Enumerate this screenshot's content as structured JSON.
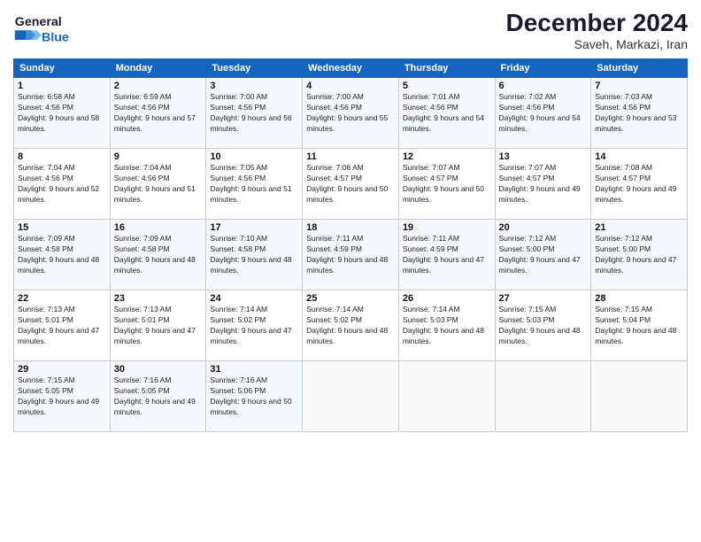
{
  "header": {
    "logo_line1": "General",
    "logo_line2": "Blue",
    "month_title": "December 2024",
    "subtitle": "Saveh, Markazi, Iran"
  },
  "weekdays": [
    "Sunday",
    "Monday",
    "Tuesday",
    "Wednesday",
    "Thursday",
    "Friday",
    "Saturday"
  ],
  "weeks": [
    [
      {
        "day": "1",
        "sunrise": "6:58 AM",
        "sunset": "4:56 PM",
        "daylight": "9 hours and 58 minutes."
      },
      {
        "day": "2",
        "sunrise": "6:59 AM",
        "sunset": "4:56 PM",
        "daylight": "9 hours and 57 minutes."
      },
      {
        "day": "3",
        "sunrise": "7:00 AM",
        "sunset": "4:56 PM",
        "daylight": "9 hours and 56 minutes."
      },
      {
        "day": "4",
        "sunrise": "7:00 AM",
        "sunset": "4:56 PM",
        "daylight": "9 hours and 55 minutes."
      },
      {
        "day": "5",
        "sunrise": "7:01 AM",
        "sunset": "4:56 PM",
        "daylight": "9 hours and 54 minutes."
      },
      {
        "day": "6",
        "sunrise": "7:02 AM",
        "sunset": "4:56 PM",
        "daylight": "9 hours and 54 minutes."
      },
      {
        "day": "7",
        "sunrise": "7:03 AM",
        "sunset": "4:56 PM",
        "daylight": "9 hours and 53 minutes."
      }
    ],
    [
      {
        "day": "8",
        "sunrise": "7:04 AM",
        "sunset": "4:56 PM",
        "daylight": "9 hours and 52 minutes."
      },
      {
        "day": "9",
        "sunrise": "7:04 AM",
        "sunset": "4:56 PM",
        "daylight": "9 hours and 51 minutes."
      },
      {
        "day": "10",
        "sunrise": "7:05 AM",
        "sunset": "4:56 PM",
        "daylight": "9 hours and 51 minutes."
      },
      {
        "day": "11",
        "sunrise": "7:06 AM",
        "sunset": "4:57 PM",
        "daylight": "9 hours and 50 minutes."
      },
      {
        "day": "12",
        "sunrise": "7:07 AM",
        "sunset": "4:57 PM",
        "daylight": "9 hours and 50 minutes."
      },
      {
        "day": "13",
        "sunrise": "7:07 AM",
        "sunset": "4:57 PM",
        "daylight": "9 hours and 49 minutes."
      },
      {
        "day": "14",
        "sunrise": "7:08 AM",
        "sunset": "4:57 PM",
        "daylight": "9 hours and 49 minutes."
      }
    ],
    [
      {
        "day": "15",
        "sunrise": "7:09 AM",
        "sunset": "4:58 PM",
        "daylight": "9 hours and 48 minutes."
      },
      {
        "day": "16",
        "sunrise": "7:09 AM",
        "sunset": "4:58 PM",
        "daylight": "9 hours and 48 minutes."
      },
      {
        "day": "17",
        "sunrise": "7:10 AM",
        "sunset": "4:58 PM",
        "daylight": "9 hours and 48 minutes."
      },
      {
        "day": "18",
        "sunrise": "7:11 AM",
        "sunset": "4:59 PM",
        "daylight": "9 hours and 48 minutes."
      },
      {
        "day": "19",
        "sunrise": "7:11 AM",
        "sunset": "4:59 PM",
        "daylight": "9 hours and 47 minutes."
      },
      {
        "day": "20",
        "sunrise": "7:12 AM",
        "sunset": "5:00 PM",
        "daylight": "9 hours and 47 minutes."
      },
      {
        "day": "21",
        "sunrise": "7:12 AM",
        "sunset": "5:00 PM",
        "daylight": "9 hours and 47 minutes."
      }
    ],
    [
      {
        "day": "22",
        "sunrise": "7:13 AM",
        "sunset": "5:01 PM",
        "daylight": "9 hours and 47 minutes."
      },
      {
        "day": "23",
        "sunrise": "7:13 AM",
        "sunset": "5:01 PM",
        "daylight": "9 hours and 47 minutes."
      },
      {
        "day": "24",
        "sunrise": "7:14 AM",
        "sunset": "5:02 PM",
        "daylight": "9 hours and 47 minutes."
      },
      {
        "day": "25",
        "sunrise": "7:14 AM",
        "sunset": "5:02 PM",
        "daylight": "9 hours and 48 minutes."
      },
      {
        "day": "26",
        "sunrise": "7:14 AM",
        "sunset": "5:03 PM",
        "daylight": "9 hours and 48 minutes."
      },
      {
        "day": "27",
        "sunrise": "7:15 AM",
        "sunset": "5:03 PM",
        "daylight": "9 hours and 48 minutes."
      },
      {
        "day": "28",
        "sunrise": "7:15 AM",
        "sunset": "5:04 PM",
        "daylight": "9 hours and 48 minutes."
      }
    ],
    [
      {
        "day": "29",
        "sunrise": "7:15 AM",
        "sunset": "5:05 PM",
        "daylight": "9 hours and 49 minutes."
      },
      {
        "day": "30",
        "sunrise": "7:16 AM",
        "sunset": "5:05 PM",
        "daylight": "9 hours and 49 minutes."
      },
      {
        "day": "31",
        "sunrise": "7:16 AM",
        "sunset": "5:06 PM",
        "daylight": "9 hours and 50 minutes."
      },
      null,
      null,
      null,
      null
    ]
  ]
}
